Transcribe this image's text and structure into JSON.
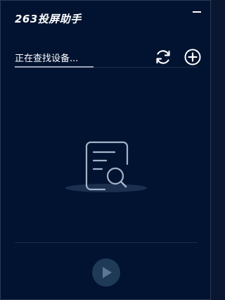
{
  "app": {
    "title": "263投屏助手"
  },
  "titlebar": {
    "minimize_icon": "minimize-icon"
  },
  "scan": {
    "status_text": "正在查找设备...",
    "progress_fraction": 0.43
  },
  "toolbar": {
    "refresh_icon": "refresh-icon",
    "add_icon": "plus-circle-icon"
  },
  "empty_state": {
    "illustration_icon": "document-search-icon"
  },
  "footer": {
    "play_icon": "play-icon"
  },
  "colors": {
    "background": "#011330",
    "text": "#ffffff",
    "accent_icon": "#9fb0c9",
    "play_button_bg": "#1e3a56",
    "play_icon": "#5c7894"
  }
}
